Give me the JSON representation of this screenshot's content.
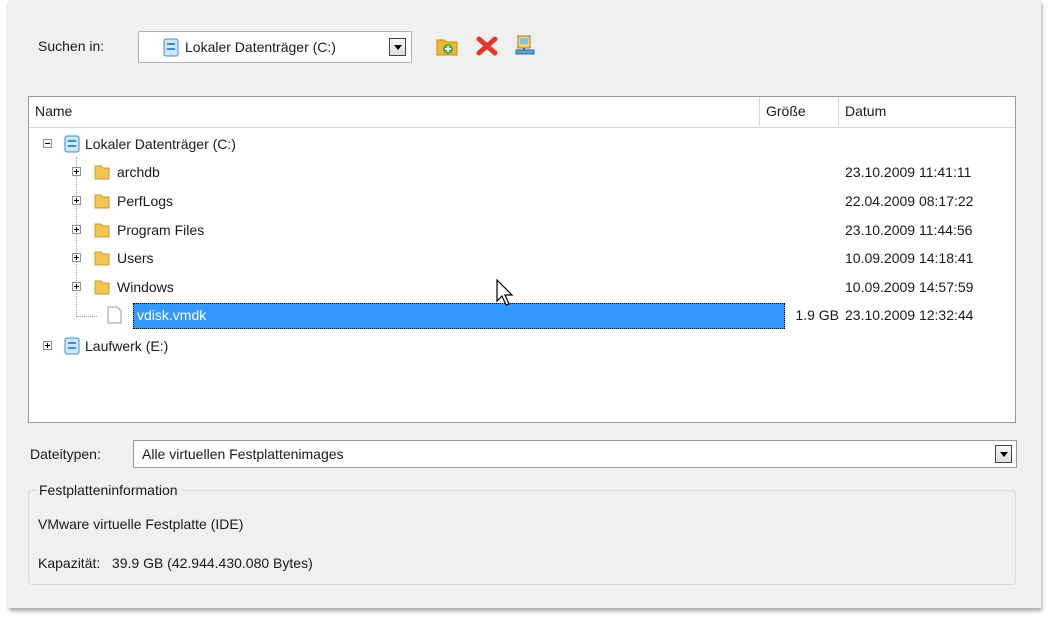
{
  "toolbar": {
    "lookin_label": "Suchen in:",
    "selected_drive": "Lokaler Datenträger (C:)",
    "icons": [
      "new-folder-icon",
      "delete-icon",
      "network-drive-icon"
    ]
  },
  "list": {
    "columns": {
      "name": "Name",
      "size": "Größe",
      "date": "Datum"
    },
    "root_c": {
      "name": "Lokaler Datenträger (C:)"
    },
    "folders": [
      {
        "name": "archdb",
        "date": "23.10.2009 11:41:11"
      },
      {
        "name": "PerfLogs",
        "date": "22.04.2009 08:17:22"
      },
      {
        "name": "Program Files",
        "date": "23.10.2009 11:44:56"
      },
      {
        "name": "Users",
        "date": "10.09.2009 14:18:41"
      },
      {
        "name": "Windows",
        "date": "10.09.2009 14:57:59"
      }
    ],
    "file": {
      "name": "vdisk.vmdk",
      "size": "1.9 GB",
      "date": "23.10.2009 12:32:44"
    },
    "root_e": {
      "name": "Laufwerk (E:)"
    }
  },
  "filetypes": {
    "label": "Dateitypen:",
    "selected": "Alle virtuellen Festplattenimages"
  },
  "diskinfo": {
    "title": "Festplatteninformation",
    "type": "VMware virtuelle Festplatte (IDE)",
    "capacity": "Kapazität:   39.9 GB (42.944.430.080 Bytes)"
  },
  "colors": {
    "selection": "#3399ff",
    "panel": "#f0f0f0"
  }
}
